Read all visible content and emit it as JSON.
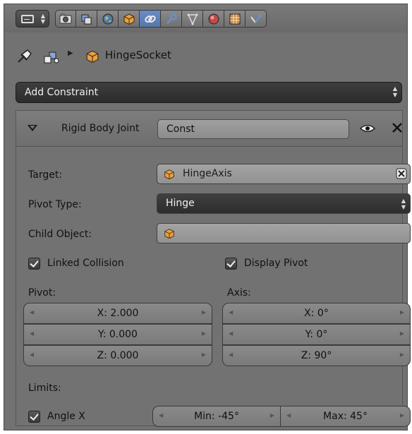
{
  "header": {
    "editor_type_icon": "properties-editor-icon",
    "tabs": [
      {
        "icon": "render-icon",
        "active": false
      },
      {
        "icon": "render-layers-icon",
        "active": false
      },
      {
        "icon": "world-icon",
        "active": false
      },
      {
        "icon": "object-icon",
        "active": false
      },
      {
        "icon": "constraint-icon",
        "active": true
      },
      {
        "icon": "modifier-wrench-icon",
        "active": false
      },
      {
        "icon": "mesh-data-icon",
        "active": false
      },
      {
        "icon": "material-icon",
        "active": false
      },
      {
        "icon": "texture-icon",
        "active": false
      },
      {
        "icon": "physics-icon",
        "active": false
      }
    ]
  },
  "breadcrumb": {
    "object_name": "HingeSocket"
  },
  "add_constraint": {
    "label": "Add Constraint"
  },
  "constraint": {
    "type_label": "Rigid Body Joint",
    "name": "Const",
    "target_label": "Target:",
    "target_value": "HingeAxis",
    "pivot_type_label": "Pivot Type:",
    "pivot_type_value": "Hinge",
    "child_object_label": "Child Object:",
    "child_object_value": "",
    "linked_collision_label": "Linked Collision",
    "linked_collision_checked": true,
    "display_pivot_label": "Display Pivot",
    "display_pivot_checked": true,
    "pivot": {
      "label": "Pivot:",
      "x": "X: 2.000",
      "y": "Y: 0.000",
      "z": "Z: 0.000"
    },
    "axis": {
      "label": "Axis:",
      "x": "X: 0°",
      "y": "Y: 0°",
      "z": "Z: 90°"
    },
    "limits_label": "Limits:",
    "angle_x_label": "Angle X",
    "angle_x_checked": true,
    "min": "Min: -45°",
    "max": "Max: 45°"
  },
  "colors": {
    "panel_bg": "#727272",
    "active_tab": "#5f82bd",
    "object_orange": "#e8a040"
  }
}
